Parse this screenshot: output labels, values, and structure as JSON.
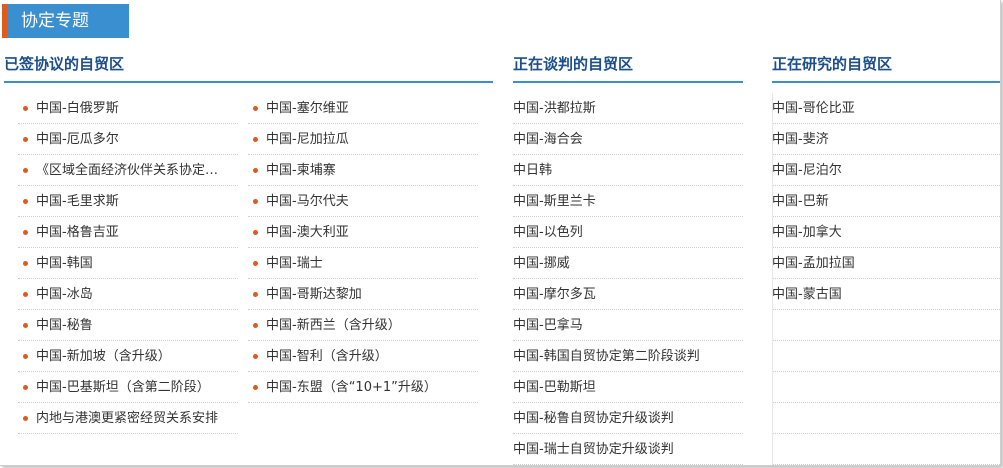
{
  "tab": {
    "label": "协定专题"
  },
  "columns": {
    "signed": {
      "title": "已签协议的自贸区",
      "left": [
        "中国-白俄罗斯",
        "中国-厄瓜多尔",
        "《区域全面经济伙伴关系协定…",
        "中国-毛里求斯",
        "中国-格鲁吉亚",
        "中国-韩国",
        "中国-冰岛",
        "中国-秘鲁",
        "中国-新加坡（含升级）",
        "中国-巴基斯坦（含第二阶段）",
        "内地与港澳更紧密经贸关系安排"
      ],
      "right": [
        "中国-塞尔维亚",
        "中国-尼加拉瓜",
        "中国-柬埔寨",
        "中国-马尔代夫",
        "中国-澳大利亚",
        "中国-瑞士",
        "中国-哥斯达黎加",
        "中国-新西兰（含升级）",
        "中国-智利（含升级）",
        "中国-东盟（含“10+1”升级）"
      ]
    },
    "negotiating": {
      "title": "正在谈判的自贸区",
      "items": [
        "中国-洪都拉斯",
        "中国-海合会",
        "中日韩",
        "中国-斯里兰卡",
        "中国-以色列",
        "中国-挪威",
        "中国-摩尔多瓦",
        "中国-巴拿马",
        "中国-韩国自贸协定第二阶段谈判",
        "中国-巴勒斯坦",
        "中国-秘鲁自贸协定升级谈判",
        "中国-瑞士自贸协定升级谈判"
      ]
    },
    "researching": {
      "title": "正在研究的自贸区",
      "items": [
        "中国-哥伦比亚",
        "中国-斐济",
        "中国-尼泊尔",
        "中国-巴新",
        "中国-加拿大",
        "中国-孟加拉国",
        "中国-蒙古国",
        "",
        "",
        "",
        "",
        ""
      ]
    }
  },
  "colors": {
    "accent": "#e05a1c",
    "tab_bg": "#3a8fd1",
    "title": "#1b4e8a"
  }
}
